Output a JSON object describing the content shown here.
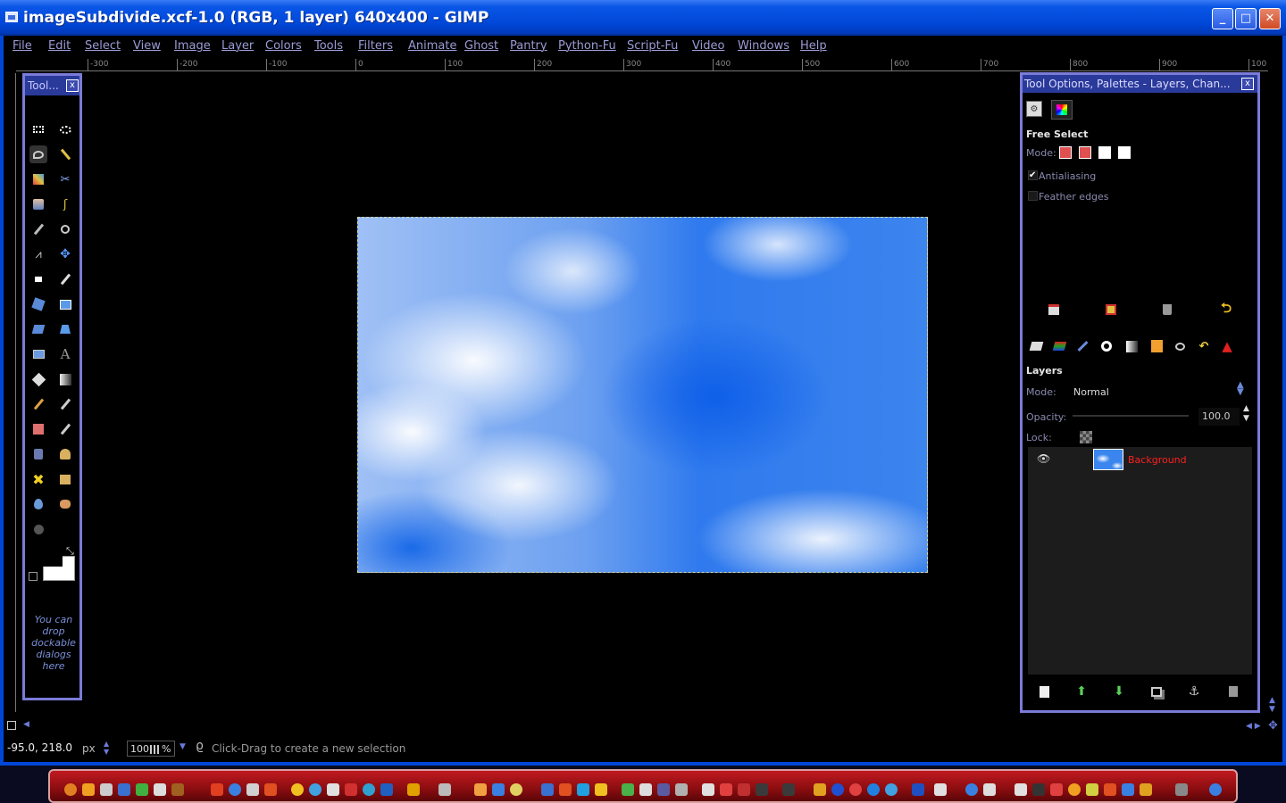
{
  "window": {
    "title": "imageSubdivide.xcf-1.0 (RGB, 1 layer) 640x400 - GIMP",
    "minimize_label": "_",
    "maximize_label": "□",
    "close_label": "✕"
  },
  "menu": {
    "items": [
      "File",
      "Edit",
      "Select",
      "View",
      "Image",
      "Layer",
      "Colors",
      "Tools",
      "Filters",
      "Animate",
      "Ghost",
      "Pantry",
      "Python-Fu",
      "Script-Fu",
      "Video",
      "Windows",
      "Help"
    ]
  },
  "ruler": {
    "labels": [
      "-300",
      "-200",
      "-100",
      "0",
      "100",
      "200",
      "300",
      "400",
      "500",
      "600",
      "700",
      "800",
      "900",
      "100"
    ]
  },
  "toolbox": {
    "title": "Tool...",
    "close_label": "x",
    "drop_hint": "You can drop dockable dialogs here",
    "tools": [
      "rect-select-icon",
      "ellipse-select-icon",
      "free-select-icon",
      "fuzzy-select-icon",
      "select-by-color-icon",
      "scissors-icon",
      "foreground-select-icon",
      "paths-icon",
      "color-picker-icon",
      "zoom-icon",
      "measure-icon",
      "move-icon",
      "align-icon",
      "crop-icon",
      "rotate-icon",
      "scale-icon",
      "shear-icon",
      "perspective-icon",
      "flip-icon",
      "text-icon",
      "bucket-fill-icon",
      "blend-icon",
      "pencil-icon",
      "paintbrush-icon",
      "eraser-icon",
      "airbrush-icon",
      "ink-icon",
      "clone-icon",
      "heal-icon",
      "perspective-clone-icon",
      "blur-icon",
      "smudge-icon",
      "dodge-burn-icon"
    ]
  },
  "dock": {
    "title": "Tool Options, Palettes - Layers, Chan...",
    "close_label": "x",
    "tool_name": "Free Select",
    "mode_label": "Mode:",
    "antialiasing_label": "Antialiasing",
    "antialiasing_checked": true,
    "feather_label": "Feather edges",
    "feather_checked": false,
    "layers_heading": "Layers",
    "layer_mode_label": "Mode:",
    "layer_mode_value": "Normal",
    "opacity_label": "Opacity:",
    "opacity_value": "100.0",
    "lock_label": "Lock:",
    "layers": [
      {
        "name": "Background",
        "visible": true,
        "color": "#ff2020"
      }
    ]
  },
  "status": {
    "coords": "-95.0, 218.0",
    "unit": "px",
    "zoom": "100",
    "zoom_suffix": "%",
    "hint": "Click-Drag to create a new selection"
  },
  "colors": {
    "title_bar": "#0047d8",
    "menu_text": "#9b9bd6",
    "panel_border": "#7b7bd8",
    "layer_name": "#ff2020",
    "taskbar": "#a01418"
  }
}
